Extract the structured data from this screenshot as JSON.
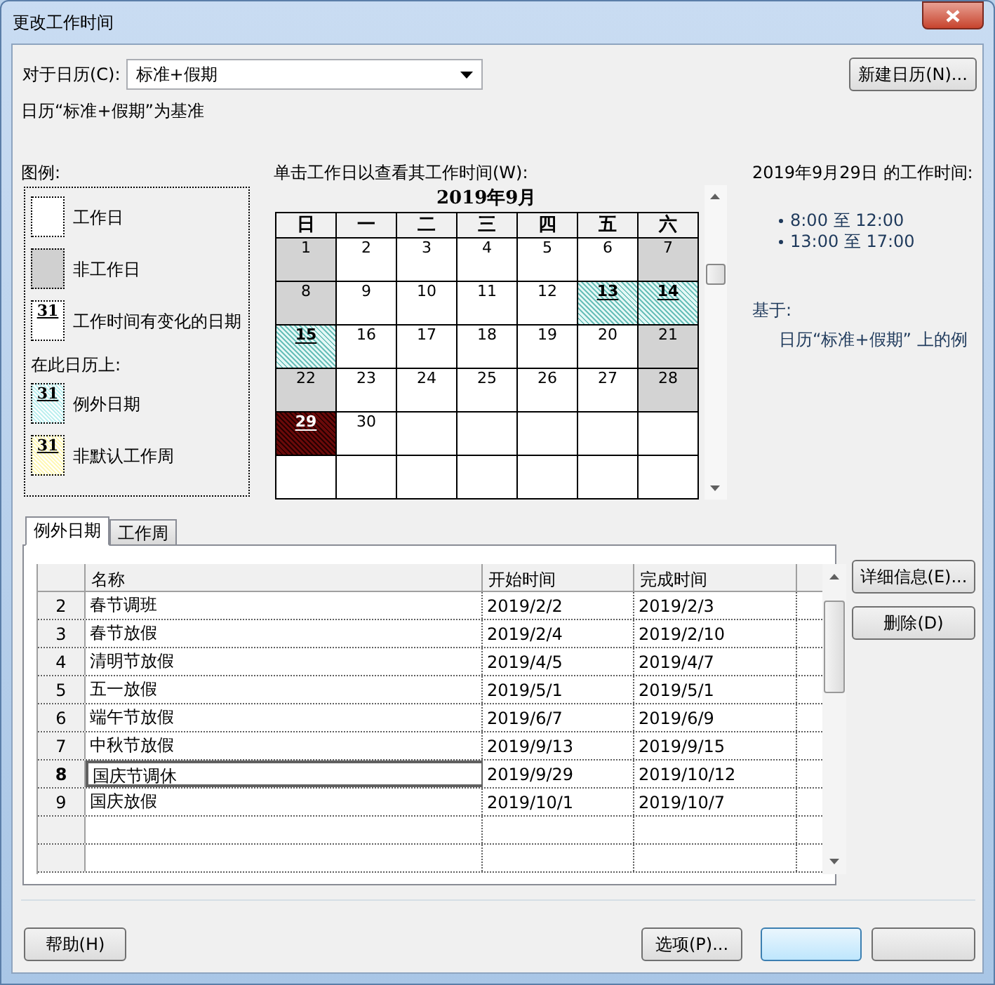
{
  "window": {
    "title": "更改工作时间"
  },
  "calendar_select": {
    "label": "对于日历(C):",
    "value": "标准+假期"
  },
  "new_calendar_button": "新建日历(N)...",
  "base_note": "日历“标准+假期”为基准",
  "legend": {
    "title": "图例:",
    "items": [
      {
        "kind": "working",
        "label": "工作日"
      },
      {
        "kind": "nonworking",
        "label": "非工作日"
      },
      {
        "kind": "changed",
        "mark": "31",
        "label": "工作时间有变化的日期"
      }
    ],
    "subtitle": "在此日历上:",
    "calendar_items": [
      {
        "kind": "exception",
        "mark": "31",
        "label": "例外日期"
      },
      {
        "kind": "nondefault",
        "mark": "31",
        "label": "非默认工作周"
      }
    ]
  },
  "calendar": {
    "hint": "单击工作日以查看其工作时间(W):",
    "month": "2019年9月",
    "weekdays": [
      "日",
      "一",
      "二",
      "三",
      "四",
      "五",
      "六"
    ],
    "weeks": [
      [
        {
          "day": "1",
          "kind": "nonworking",
          "selected": false
        },
        {
          "day": "2",
          "kind": "working",
          "selected": false
        },
        {
          "day": "3",
          "kind": "working",
          "selected": false
        },
        {
          "day": "4",
          "kind": "working",
          "selected": false
        },
        {
          "day": "5",
          "kind": "working",
          "selected": false
        },
        {
          "day": "6",
          "kind": "working",
          "selected": false
        },
        {
          "day": "7",
          "kind": "nonworking",
          "selected": false
        }
      ],
      [
        {
          "day": "8",
          "kind": "nonworking",
          "selected": false
        },
        {
          "day": "9",
          "kind": "working",
          "selected": false
        },
        {
          "day": "10",
          "kind": "working",
          "selected": false
        },
        {
          "day": "11",
          "kind": "working",
          "selected": false
        },
        {
          "day": "12",
          "kind": "working",
          "selected": false
        },
        {
          "day": "13",
          "kind": "exception",
          "selected": false
        },
        {
          "day": "14",
          "kind": "exception",
          "selected": false
        }
      ],
      [
        {
          "day": "15",
          "kind": "exception",
          "selected": false
        },
        {
          "day": "16",
          "kind": "working",
          "selected": false
        },
        {
          "day": "17",
          "kind": "working",
          "selected": false
        },
        {
          "day": "18",
          "kind": "working",
          "selected": false
        },
        {
          "day": "19",
          "kind": "working",
          "selected": false
        },
        {
          "day": "20",
          "kind": "working",
          "selected": false
        },
        {
          "day": "21",
          "kind": "nonworking",
          "selected": false
        }
      ],
      [
        {
          "day": "22",
          "kind": "nonworking",
          "selected": false
        },
        {
          "day": "23",
          "kind": "working",
          "selected": false
        },
        {
          "day": "24",
          "kind": "working",
          "selected": false
        },
        {
          "day": "25",
          "kind": "working",
          "selected": false
        },
        {
          "day": "26",
          "kind": "working",
          "selected": false
        },
        {
          "day": "27",
          "kind": "working",
          "selected": false
        },
        {
          "day": "28",
          "kind": "nonworking",
          "selected": false
        }
      ],
      [
        {
          "day": "29",
          "kind": "exception",
          "selected": true
        },
        {
          "day": "30",
          "kind": "working",
          "selected": false
        },
        {
          "kind": "blank"
        },
        {
          "kind": "blank"
        },
        {
          "kind": "blank"
        },
        {
          "kind": "blank"
        },
        {
          "kind": "blank"
        }
      ],
      [
        {
          "kind": "blank"
        },
        {
          "kind": "blank"
        },
        {
          "kind": "blank"
        },
        {
          "kind": "blank"
        },
        {
          "kind": "blank"
        },
        {
          "kind": "blank"
        },
        {
          "kind": "blank"
        }
      ]
    ]
  },
  "working_times": {
    "title": "2019年9月29日 的工作时间:",
    "items": [
      "8:00 至 12:00",
      "13:00 至 17:00"
    ],
    "based_on_label": "基于:",
    "based_on": "日历“标准+假期” 上的例"
  },
  "tabs": [
    {
      "label": "例外日期",
      "selected": true
    },
    {
      "label": "工作周",
      "selected": false
    }
  ],
  "table": {
    "columns": [
      "名称",
      "开始时间",
      "完成时间"
    ],
    "rows": [
      {
        "number": "2",
        "name": "春节调班",
        "start": "2019/2/2",
        "finish": "2019/2/3",
        "selected": false
      },
      {
        "number": "3",
        "name": "春节放假",
        "start": "2019/2/4",
        "finish": "2019/2/10",
        "selected": false
      },
      {
        "number": "4",
        "name": "清明节放假",
        "start": "2019/4/5",
        "finish": "2019/4/7",
        "selected": false
      },
      {
        "number": "5",
        "name": "五一放假",
        "start": "2019/5/1",
        "finish": "2019/5/1",
        "selected": false
      },
      {
        "number": "6",
        "name": "端午节放假",
        "start": "2019/6/7",
        "finish": "2019/6/9",
        "selected": false
      },
      {
        "number": "7",
        "name": "中秋节放假",
        "start": "2019/9/13",
        "finish": "2019/9/15",
        "selected": false
      },
      {
        "number": "8",
        "name": "国庆节调休",
        "start": "2019/9/29",
        "finish": "2019/10/12",
        "selected": true
      },
      {
        "number": "9",
        "name": "国庆放假",
        "start": "2019/10/1",
        "finish": "2019/10/7",
        "selected": false
      }
    ]
  },
  "side_buttons": [
    "详细信息(E)...",
    "删除(D)"
  ],
  "footer": {
    "help": "帮助(H)",
    "options": "选项(P)..."
  }
}
